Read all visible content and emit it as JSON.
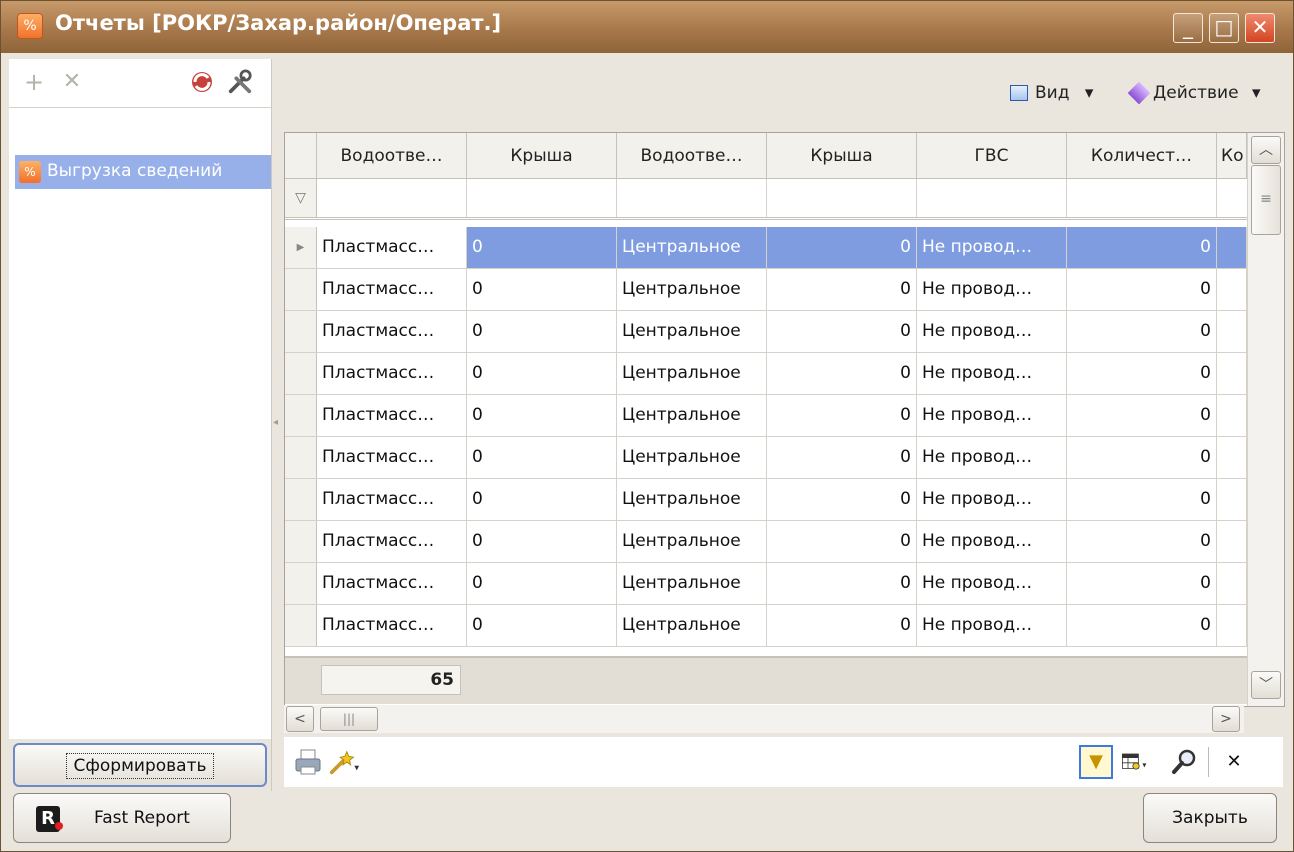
{
  "window": {
    "title": "Отчеты [РОКР/Захар.район/Операт.]",
    "icon": "percent-icon",
    "controls": {
      "minimize": "_",
      "maximize": "□",
      "close": "✕"
    }
  },
  "left_toolbar": {
    "add": "+",
    "delete": "✕"
  },
  "tree": {
    "items": [
      {
        "label": "Выгрузка сведений"
      }
    ]
  },
  "view_bar": {
    "view_label": "Вид",
    "action_label": "Действие",
    "dropdown_glyph": "▾"
  },
  "grid": {
    "columns": [
      "Водоотве…",
      "Крыша",
      "Водоотве…",
      "Крыша",
      "ГВС",
      "Количест…",
      "Ко"
    ],
    "rows": [
      {
        "c0": "Пластмасс…",
        "c1": "0",
        "c2": "Центральное",
        "c3": "0",
        "c4": "Не провод…",
        "c5": "0"
      },
      {
        "c0": "Пластмасс…",
        "c1": "0",
        "c2": "Центральное",
        "c3": "0",
        "c4": "Не провод…",
        "c5": "0"
      },
      {
        "c0": "Пластмасс…",
        "c1": "0",
        "c2": "Центральное",
        "c3": "0",
        "c4": "Не провод…",
        "c5": "0"
      },
      {
        "c0": "Пластмасс…",
        "c1": "0",
        "c2": "Центральное",
        "c3": "0",
        "c4": "Не провод…",
        "c5": "0"
      },
      {
        "c0": "Пластмасс…",
        "c1": "0",
        "c2": "Центральное",
        "c3": "0",
        "c4": "Не провод…",
        "c5": "0"
      },
      {
        "c0": "Пластмасс…",
        "c1": "0",
        "c2": "Центральное",
        "c3": "0",
        "c4": "Не провод…",
        "c5": "0"
      },
      {
        "c0": "Пластмасс…",
        "c1": "0",
        "c2": "Центральное",
        "c3": "0",
        "c4": "Не провод…",
        "c5": "0"
      },
      {
        "c0": "Пластмасс…",
        "c1": "0",
        "c2": "Центральное",
        "c3": "0",
        "c4": "Не провод…",
        "c5": "0"
      },
      {
        "c0": "Пластмасс…",
        "c1": "0",
        "c2": "Центральное",
        "c3": "0",
        "c4": "Не провод…",
        "c5": "0"
      },
      {
        "c0": "Пластмасс…",
        "c1": "0",
        "c2": "Центральное",
        "c3": "0",
        "c4": "Не провод…",
        "c5": "0"
      }
    ],
    "footer_total": "65",
    "selected_row": 0
  },
  "bottom_toolbar": {
    "close_glyph": "✕"
  },
  "buttons": {
    "form": "Сформировать",
    "fast_report": "Fast Report",
    "fast_report_logo": "R",
    "close": "Закрыть"
  },
  "colors": {
    "title_bar": "#a7784b",
    "selection": "#7f9ce0",
    "tree_selection": "#98b0ea",
    "close_button": "#d24522"
  }
}
